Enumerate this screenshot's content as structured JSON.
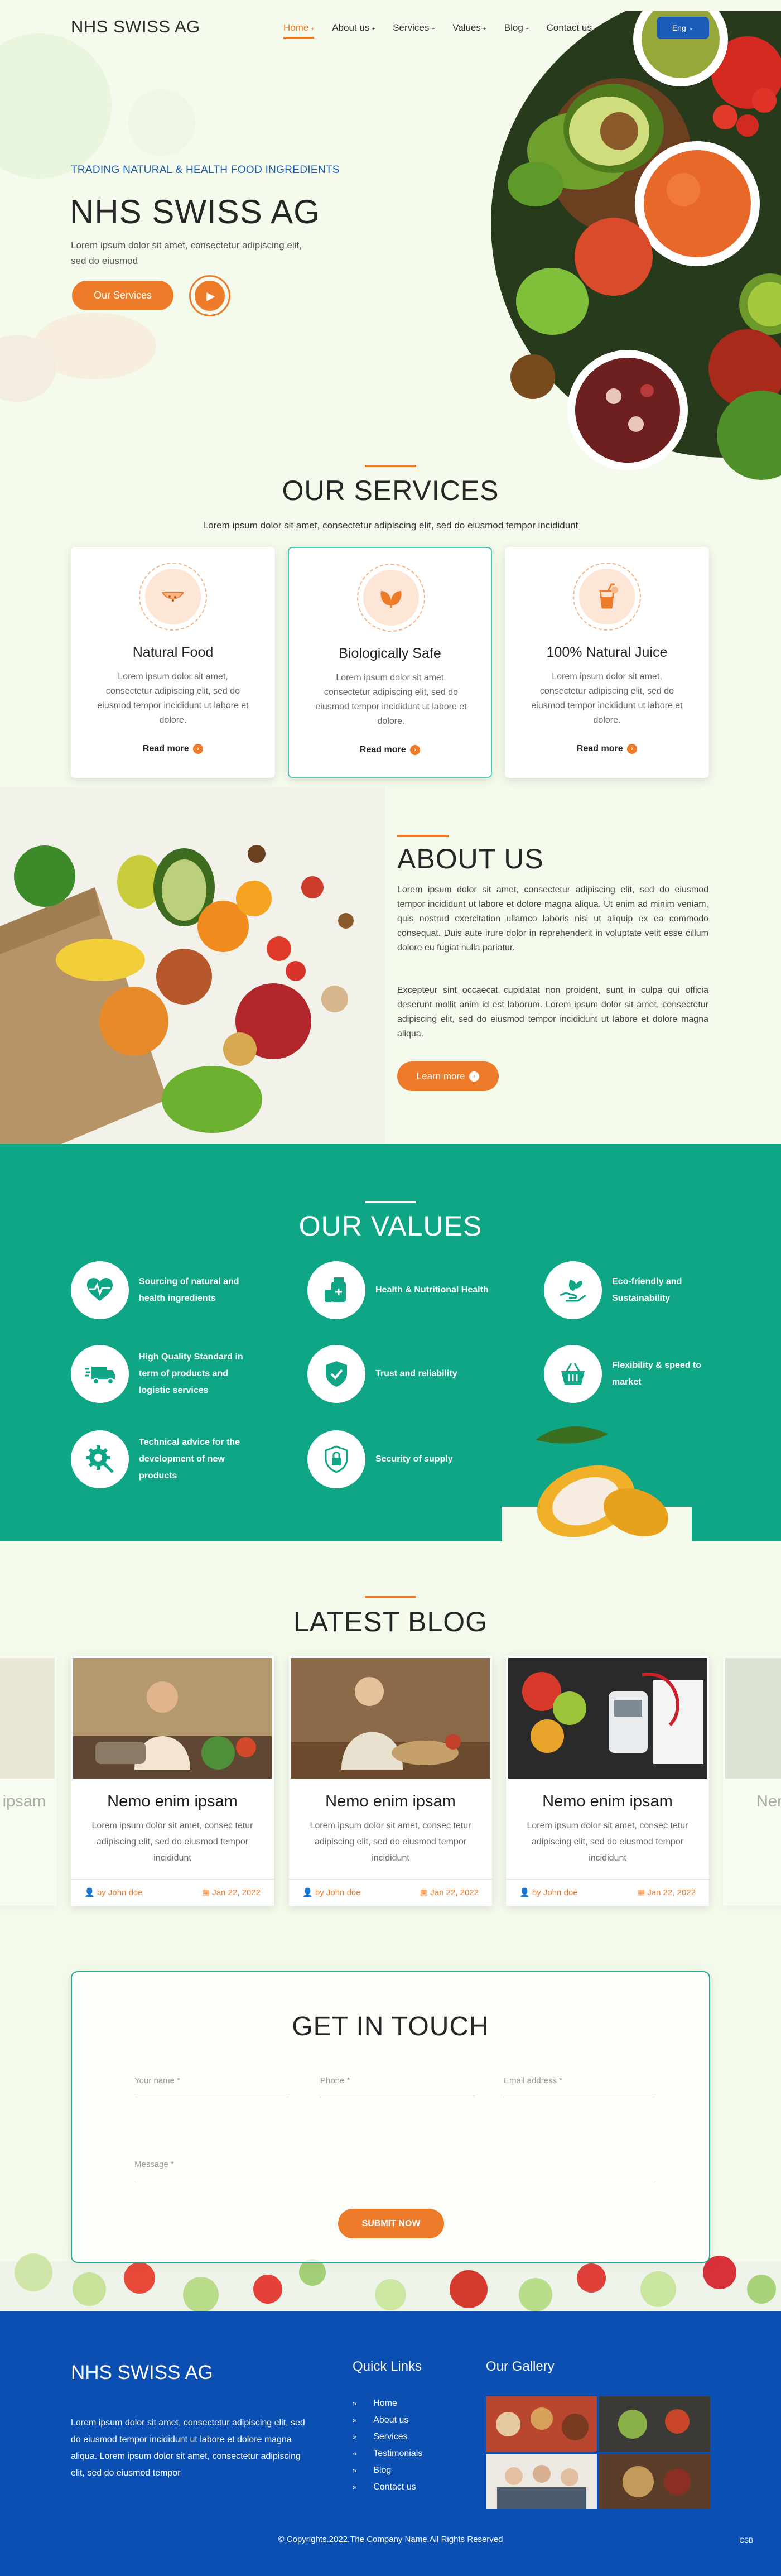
{
  "header": {
    "logo": "NHS SWISS AG",
    "nav": [
      {
        "label": "Home",
        "has_caret": true,
        "active": true
      },
      {
        "label": "About us",
        "has_caret": true
      },
      {
        "label": "Services",
        "has_caret": true
      },
      {
        "label": "Values",
        "has_caret": true
      },
      {
        "label": "Blog",
        "has_caret": true
      },
      {
        "label": "Contact us",
        "has_caret": false
      }
    ],
    "lang": "Eng"
  },
  "hero": {
    "tagline": "TRADING NATURAL & HEALTH FOOD INGREDIENTS",
    "title": "NHS SWISS AG",
    "desc": "Lorem ipsum dolor sit amet, consectetur adipiscing elit, sed do eiusmod",
    "button": "Our Services"
  },
  "services": {
    "title": "OUR SERVICES",
    "subtitle": "Lorem ipsum dolor sit amet, consectetur adipiscing elit, sed do eiusmod tempor incididunt",
    "cards": [
      {
        "title": "Natural Food",
        "desc": "Lorem ipsum dolor sit amet, consectetur adipiscing elit, sed do eiusmod tempor incididunt ut labore et dolore.",
        "more": "Read more",
        "icon": "watermelon-icon"
      },
      {
        "title": "Biologically Safe",
        "desc": "Lorem ipsum dolor sit amet, consectetur adipiscing elit, sed do eiusmod tempor incididunt ut labore et dolore.",
        "more": "Read more",
        "icon": "leaf-icon"
      },
      {
        "title": "100% Natural Juice",
        "desc": "Lorem ipsum dolor sit amet, consectetur adipiscing elit, sed do eiusmod tempor incididunt ut labore et dolore.",
        "more": "Read more",
        "icon": "juice-icon"
      }
    ]
  },
  "about": {
    "title": "ABOUT US",
    "p1": "Lorem ipsum dolor sit amet, consectetur adipiscing elit, sed do eiusmod tempor incididunt ut labore et dolore magna aliqua. Ut enim ad minim veniam, quis nostrud exercitation ullamco laboris nisi ut aliquip ex ea commodo consequat. Duis aute irure dolor in reprehenderit in voluptate velit esse cillum dolore eu fugiat nulla pariatur.",
    "p2": "Excepteur sint occaecat cupidatat non proident, sunt in culpa qui officia deserunt mollit anim id est laborum. Lorem ipsum dolor sit amet, consectetur adipiscing elit, sed do eiusmod tempor incididunt ut labore et dolore magna aliqua.",
    "button": "Learn more"
  },
  "values": {
    "title": "OUR VALUES",
    "items": [
      {
        "label": "Sourcing of natural and health ingredients",
        "icon": "heart-pulse-icon"
      },
      {
        "label": "Health & Nutritional Health",
        "icon": "supplement-bottle-icon"
      },
      {
        "label": "Eco-friendly and Sustainability",
        "icon": "hand-leaf-icon"
      },
      {
        "label": "High Quality Standard in term of products and logistic services",
        "icon": "delivery-truck-icon"
      },
      {
        "label": "Trust and reliability",
        "icon": "shield-check-icon"
      },
      {
        "label": "Flexibility & speed to market",
        "icon": "basket-icon"
      },
      {
        "label": "Technical advice for the development of new products",
        "icon": "gear-search-icon"
      },
      {
        "label": "Security of supply",
        "icon": "shield-lock-icon"
      }
    ]
  },
  "blog": {
    "title": "LATEST BLOG",
    "ghost_title": "Nemo enim ipsam",
    "posts": [
      {
        "title": "Nemo enim ipsam",
        "desc": "Lorem ipsum dolor sit amet, consec tetur adipiscing elit, sed do eiusmod tempor incididunt",
        "author": "by John doe",
        "date": "Jan 22, 2022"
      },
      {
        "title": "Nemo enim ipsam",
        "desc": "Lorem ipsum dolor sit amet, consec tetur adipiscing elit, sed do eiusmod tempor incididunt",
        "author": "by John doe",
        "date": "Jan 22, 2022"
      },
      {
        "title": "Nemo enim ipsam",
        "desc": "Lorem ipsum dolor sit amet, consec tetur adipiscing elit, sed do eiusmod tempor incididunt",
        "author": "by John doe",
        "date": "Jan 22, 2022"
      }
    ]
  },
  "contact": {
    "title": "GET IN TOUCH",
    "name_ph": "Your name *",
    "phone_ph": "Phone *",
    "email_ph": "Email address *",
    "message_ph": "Message *",
    "button": "SUBMIT NOW"
  },
  "footer": {
    "logo": "NHS SWISS AG",
    "desc": "Lorem ipsum dolor sit amet, consectetur adipiscing elit, sed do eiusmod tempor incididunt ut labore et dolore magna aliqua. Lorem ipsum dolor sit amet, consectetur adipiscing elit, sed do eiusmod tempor",
    "links_title": "Quick Links",
    "links": [
      "Home",
      "About us",
      "Services",
      "Testimonials",
      "Blog",
      "Contact us"
    ],
    "gallery_title": "Our Gallery",
    "copyright": "© Copyrights.2022.The Company Name.All Rights Reserved",
    "badge": "CSB"
  },
  "colors": {
    "accent": "#ee7b2a",
    "teal": "#0ea684",
    "blue": "#0b4fb3",
    "lang_button": "#1b5bb8"
  }
}
